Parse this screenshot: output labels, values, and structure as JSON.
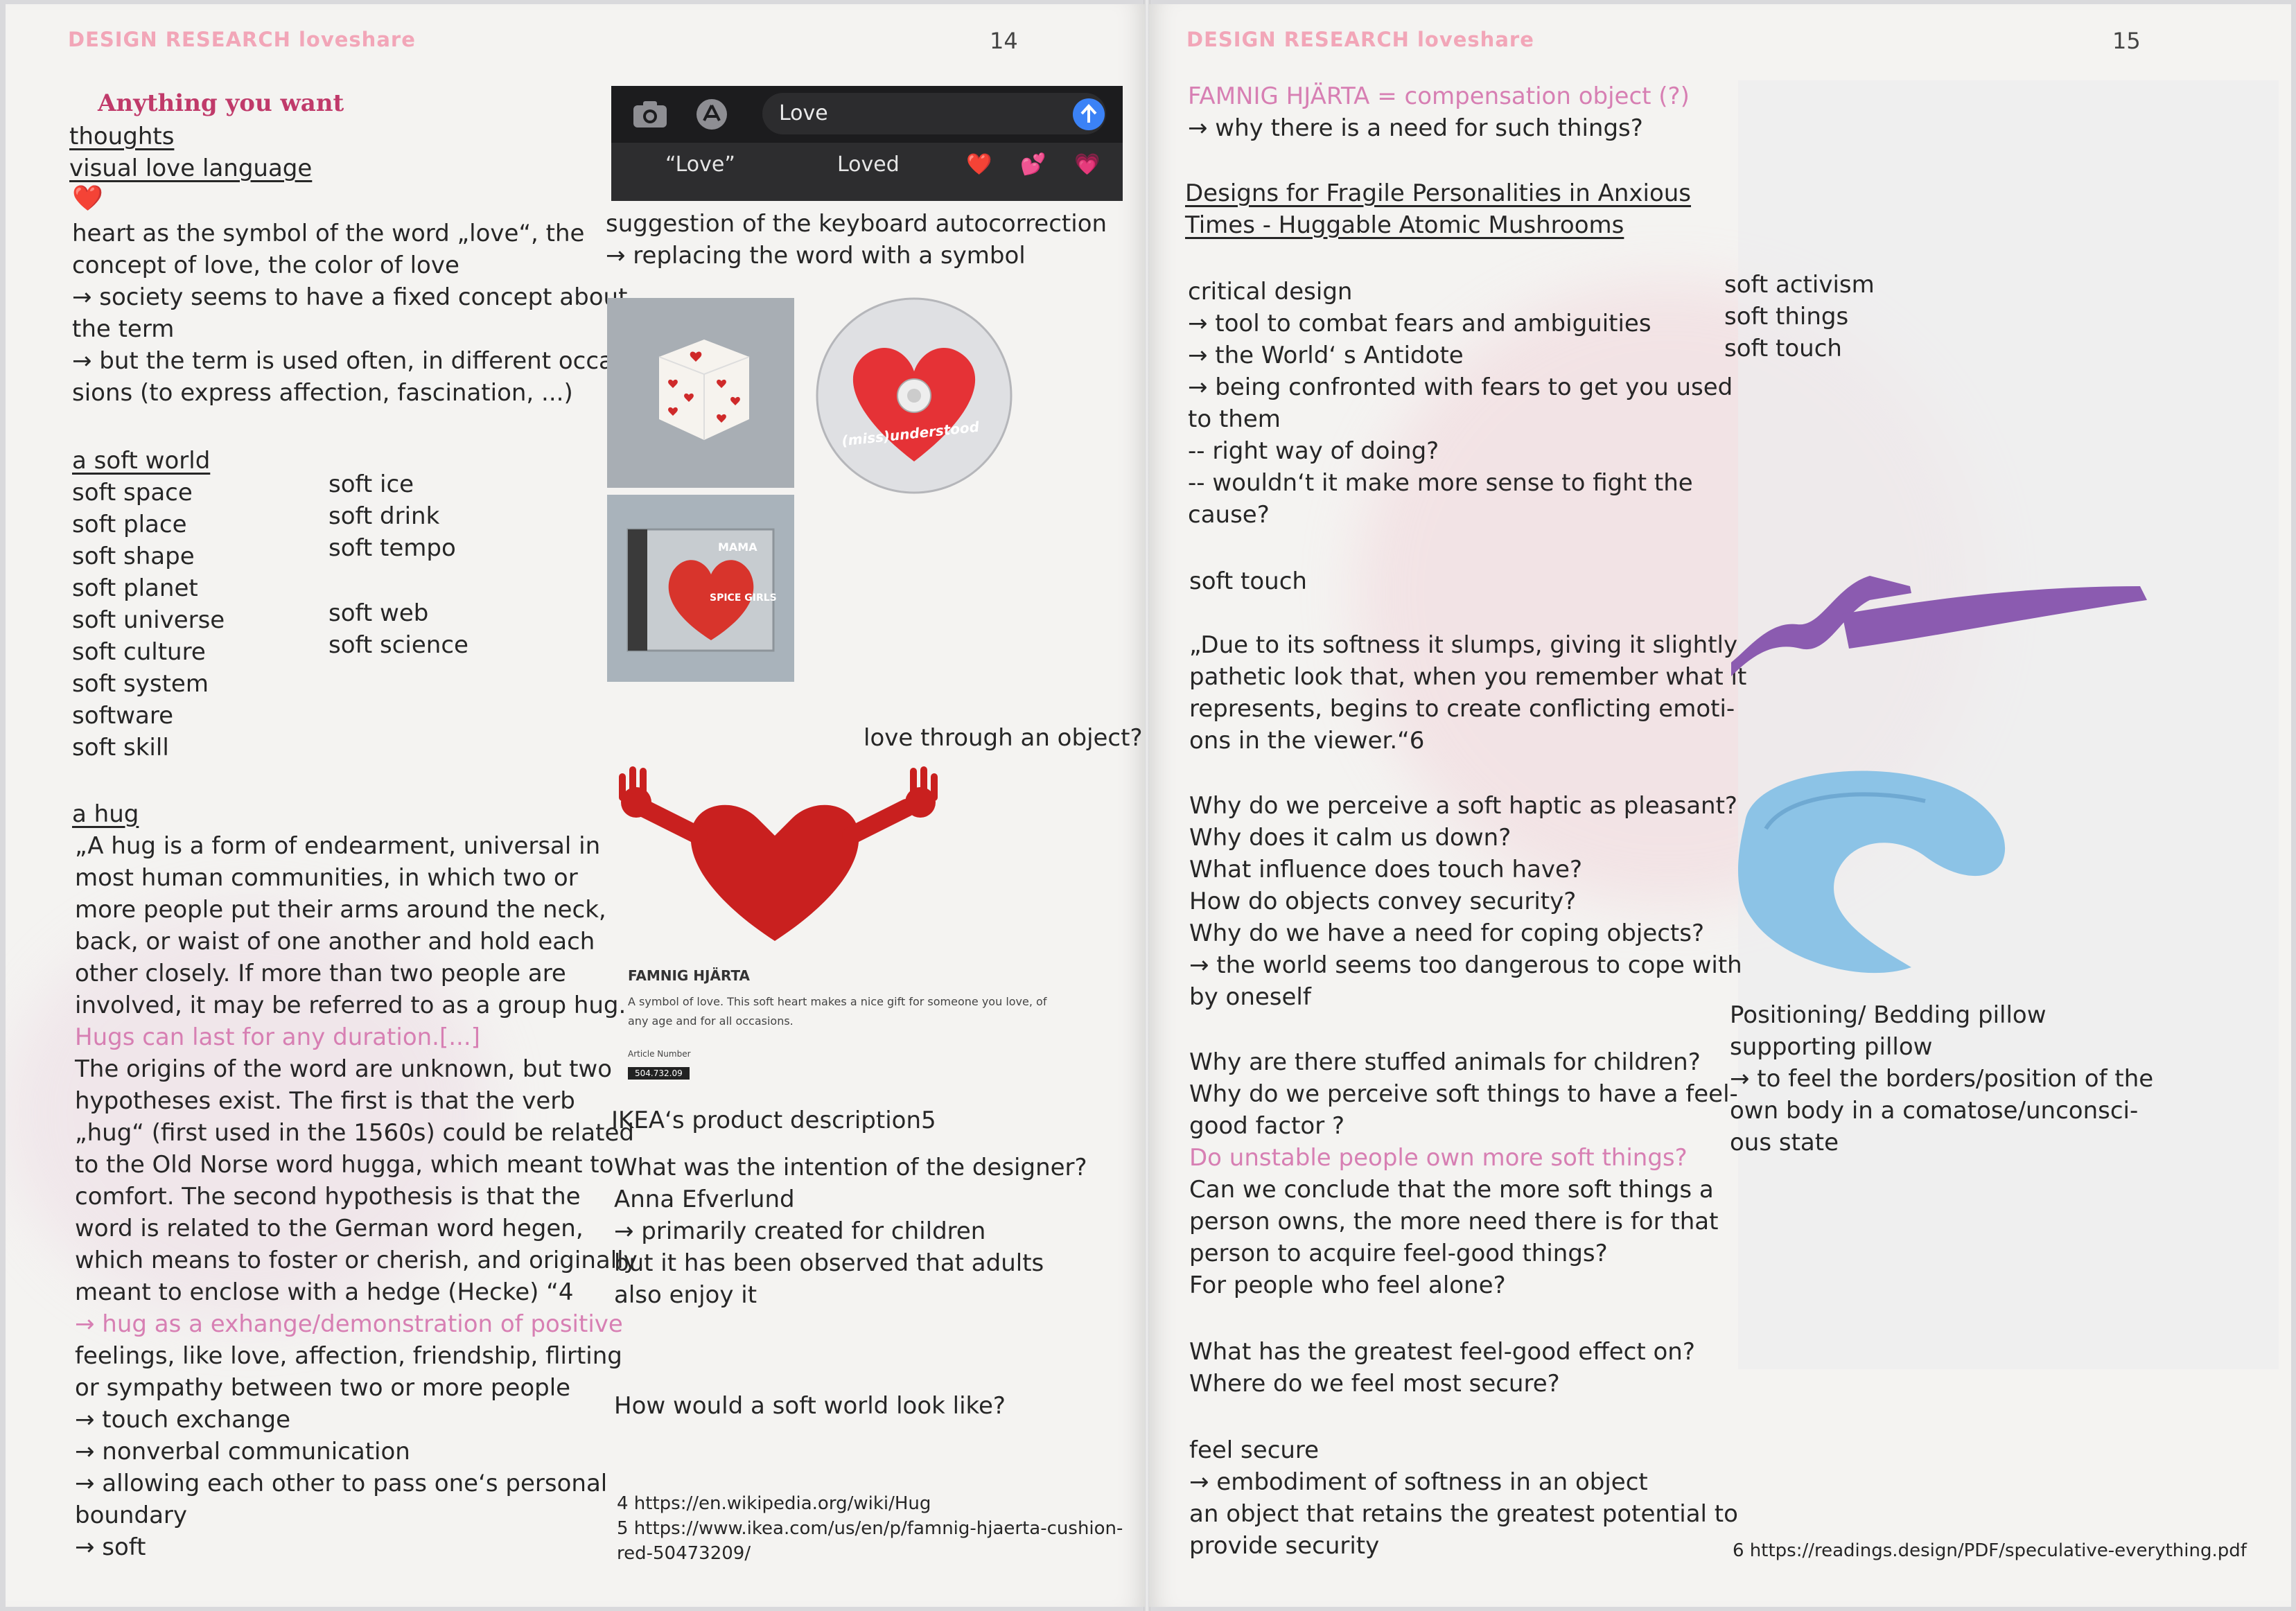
{
  "left_page": {
    "running_head": "DESIGN RESEARCH     loveshare",
    "page_number": "14",
    "title": "Anything you want",
    "col1": {
      "lines": [
        "thoughts",
        "visual love language",
        "heart as the symbol of the word „love“, the",
        "concept of love, the color of love",
        "→ society seems to have a fixed concept about",
        "the term",
        "→ but the term is used often, in different occa-",
        "sions (to express affection, fascination, ...)"
      ],
      "heart_emoji": "❤️",
      "soft_world_heading": "a soft world",
      "soft_world_a": [
        "soft space",
        "soft place",
        "soft shape",
        "soft planet",
        "soft universe",
        "soft culture",
        "soft system",
        "software",
        "soft skill"
      ],
      "soft_world_b": [
        "soft ice",
        "soft drink",
        "soft tempo"
      ],
      "soft_world_c": [
        "soft web",
        "soft science"
      ],
      "hug_heading": "a hug",
      "hug_lines": [
        "„A hug is a form of endearment, universal in",
        "most human communities, in which two or",
        "more people put their arms around the neck,",
        "back, or waist of one another and hold each",
        "other closely. If more than two people are",
        "involved, it may be referred to as a group hug.",
        "Hugs can last for any duration.[...]",
        "The origins of the word are unknown, but two",
        "hypotheses exist. The first is that the verb",
        "„hug“ (first used in the 1560s) could be related",
        "to the Old Norse word hugga, which meant to",
        "comfort. The second hypothesis is that the",
        "word is related to the German word hegen,",
        "which means to foster or cherish, and originally",
        "meant to enclose with a hedge (Hecke) “4",
        "→ hug as a exhange/demonstration of positive",
        "feelings, like love, affection, friendship, flirting",
        "or sympathy between two or more people",
        "→ touch exchange",
        "→ nonverbal communication",
        "→ allowing each other to pass one‘s personal",
        "boundary",
        "→ soft"
      ]
    },
    "col2": {
      "keyboard": {
        "input_text": "Love",
        "suggestion_1": "“Love”",
        "suggestion_2": "Loved",
        "emoji_1": "❤️",
        "emoji_2": "💕",
        "emoji_3": "💗"
      },
      "caption_1": "suggestion of the keyboard autocorrection",
      "caption_2": "→ replacing the word with a symbol",
      "cd_label": "(miss)understood",
      "cd_case_text_1": "MAMA",
      "cd_case_text_2": "SPICE GIRLS",
      "question": "love through an object?",
      "product_title": "FAMNIG HJÄRTA",
      "product_desc_1": "A symbol of love. This soft heart makes a nice gift for someone you love, of",
      "product_desc_2": "any age and for all occasions.",
      "article_label": "Article Number",
      "article_number": "504.732.09",
      "ikea_caption": "IKEA‘s product description5",
      "designer_lines": [
        "What was the intention of the designer?",
        "Anna Efverlund",
        "→ primarily created for children",
        "but it has been observed that adults",
        "also enjoy it"
      ],
      "soft_world_question": "How would a soft world look like?",
      "footnotes": [
        "4 https://en.wikipedia.org/wiki/Hug",
        "5 https://www.ikea.com/us/en/p/famnig-hjaerta-cushion-",
        "red-50473209/"
      ]
    }
  },
  "right_page": {
    "running_head": "DESIGN RESEARCH     loveshare",
    "page_number": "15",
    "col1": {
      "famnig_line": "FAMNIG HJÄRTA = compensation object (?)",
      "famnig_line_2": "→ why there is a need for such things?",
      "designs_heading_1": "Designs for Fragile Personalities in Anxious",
      "designs_heading_2": "Times - Huggable Atomic Mushrooms",
      "critical_lines": [
        "critical design",
        "→ tool to combat fears and ambiguities",
        "→ the World‘ s Antidote",
        "→ being confronted with fears to get you used",
        "to them",
        "-- right way of doing?",
        "-- wouldn‘t it make more sense to fight the",
        "cause?"
      ],
      "soft_touch": "soft touch",
      "quote_lines": [
        "„Due to its softness it slumps, giving it slightly",
        "pathetic look that, when you remember what it",
        "represents, begins to create conflicting emoti-",
        "ons in the viewer.“6"
      ],
      "why_lines": [
        "Why do we perceive a soft haptic as pleasant?",
        "Why does it calm us down?",
        "What influence does touch have?",
        "How do objects convey security?",
        "Why do we have a need for coping objects?",
        "→ the world seems too dangerous to cope with",
        "by oneself"
      ],
      "stuffed_lines": [
        "Why are there stuffed animals for children?",
        "Why do we perceive soft things to have a feel-",
        "good factor ?",
        "Do unstable people own more soft things?",
        "Can we conclude that the more soft things a",
        "person owns, the more need there is for that",
        "person to acquire feel-good things?",
        "For people who feel alone?"
      ],
      "greatest_lines": [
        "What has the greatest feel-good effect on?",
        "Where do we feel most secure?"
      ],
      "secure_lines": [
        "feel secure",
        "→ embodiment of softness in an object",
        "an object that retains the greatest potential to",
        "provide security"
      ]
    },
    "col2": {
      "soft_list": [
        "soft activism",
        "soft things",
        "soft touch"
      ],
      "pillow_lines": [
        "Positioning/ Bedding pillow",
        "supporting pillow",
        "→ to feel the borders/position of the",
        "own body in a comatose/unconsci-",
        "ous state"
      ],
      "footnote": "6 https://readings.design/PDF/speculative-everything.pdf"
    }
  },
  "colors": {
    "accent_pink": "#d77fb3",
    "heart_red": "#d8272c",
    "pillow_purple": "#8b5bb0",
    "pillow_blue": "#8cc3e6"
  }
}
